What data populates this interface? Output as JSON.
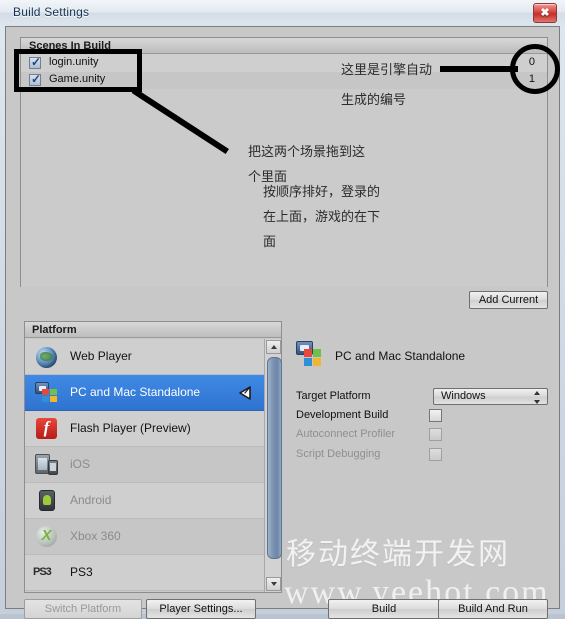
{
  "window": {
    "title": "Build Settings",
    "close_icon": "close-icon",
    "close_glyph": "✖"
  },
  "scenes_panel": {
    "header": "Scenes In Build",
    "add_current_label": "Add Current",
    "scenes": [
      {
        "name": "login.unity",
        "index": "0",
        "checked": true,
        "check_glyph": "✓"
      },
      {
        "name": "Game.unity",
        "index": "1",
        "checked": true,
        "check_glyph": "✓"
      }
    ]
  },
  "platform_panel": {
    "header": "Platform",
    "items": [
      {
        "label": "Web Player",
        "icon": "globe-icon",
        "selected": false,
        "dim": false
      },
      {
        "label": "PC and Mac Standalone",
        "icon": "pc-mac-icon",
        "selected": true,
        "dim": false
      },
      {
        "label": "Flash Player (Preview)",
        "icon": "flash-icon",
        "selected": false,
        "dim": false
      },
      {
        "label": "iOS",
        "icon": "ios-icon",
        "selected": false,
        "dim": true
      },
      {
        "label": "Android",
        "icon": "android-icon",
        "selected": false,
        "dim": true
      },
      {
        "label": "Xbox 360",
        "icon": "xbox-icon",
        "selected": false,
        "dim": true
      },
      {
        "label": "PS3",
        "icon": "ps3-icon",
        "selected": false,
        "dim": false
      }
    ],
    "ps3_logo_text": "PS3",
    "flash_glyph": "f",
    "xbox_glyph": "X",
    "unity_badge_icon": "unity-logo-icon"
  },
  "settings_panel": {
    "title": "PC and Mac Standalone",
    "target_platform_label": "Target Platform",
    "target_platform_value": "Windows",
    "development_build_label": "Development Build",
    "autoconnect_profiler_label": "Autoconnect Profiler",
    "script_debugging_label": "Script Debugging",
    "development_build_checked": false,
    "autoconnect_profiler_checked": false,
    "script_debugging_checked": false
  },
  "footer": {
    "switch_platform_label": "Switch Platform",
    "switch_platform_disabled": true,
    "player_settings_label": "Player Settings...",
    "build_label": "Build",
    "build_and_run_label": "Build And Run"
  },
  "annotations": {
    "drag_scenes_line1": "把这两个场景拖到这",
    "drag_scenes_line2": "个里面",
    "order_note_line1": "按顺序排好，登录的",
    "order_note_line2": "在上面，游戏的在下",
    "order_note_line3": "面",
    "auto_index_line1": "这里是引擎自动",
    "auto_index_line2": "生成的编号"
  },
  "watermark": {
    "chinese": "移动终端开发网",
    "url": "www.yeehot.com"
  },
  "colors": {
    "selection_blue": "#3079d0",
    "panel_gray": "#c8c8c8",
    "annotation_black": "#000000",
    "close_red": "#d9423c"
  }
}
